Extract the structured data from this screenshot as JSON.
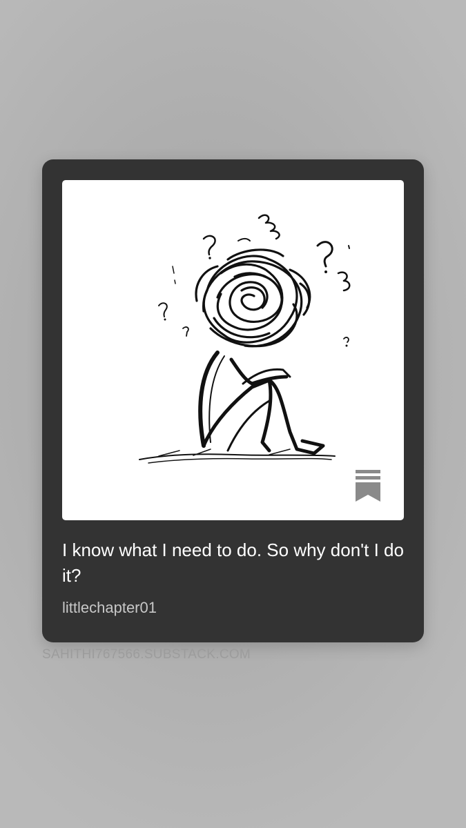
{
  "card": {
    "title": "I know what I need to do. So why don't I do it?",
    "author": "littlechapter01",
    "image": {
      "description_icon": "tangled-thoughts-figure-illustration"
    },
    "bookmark_icon": "substack-bookmark-icon"
  },
  "source": {
    "domain": "SAHITHI767566.SUBSTACK.COM"
  },
  "colors": {
    "card_bg": "#333333",
    "title_text": "#ffffff",
    "author_text": "#c8c8c8",
    "domain_text": "#9c9c9c",
    "bookmark": "#8a8a8a"
  }
}
